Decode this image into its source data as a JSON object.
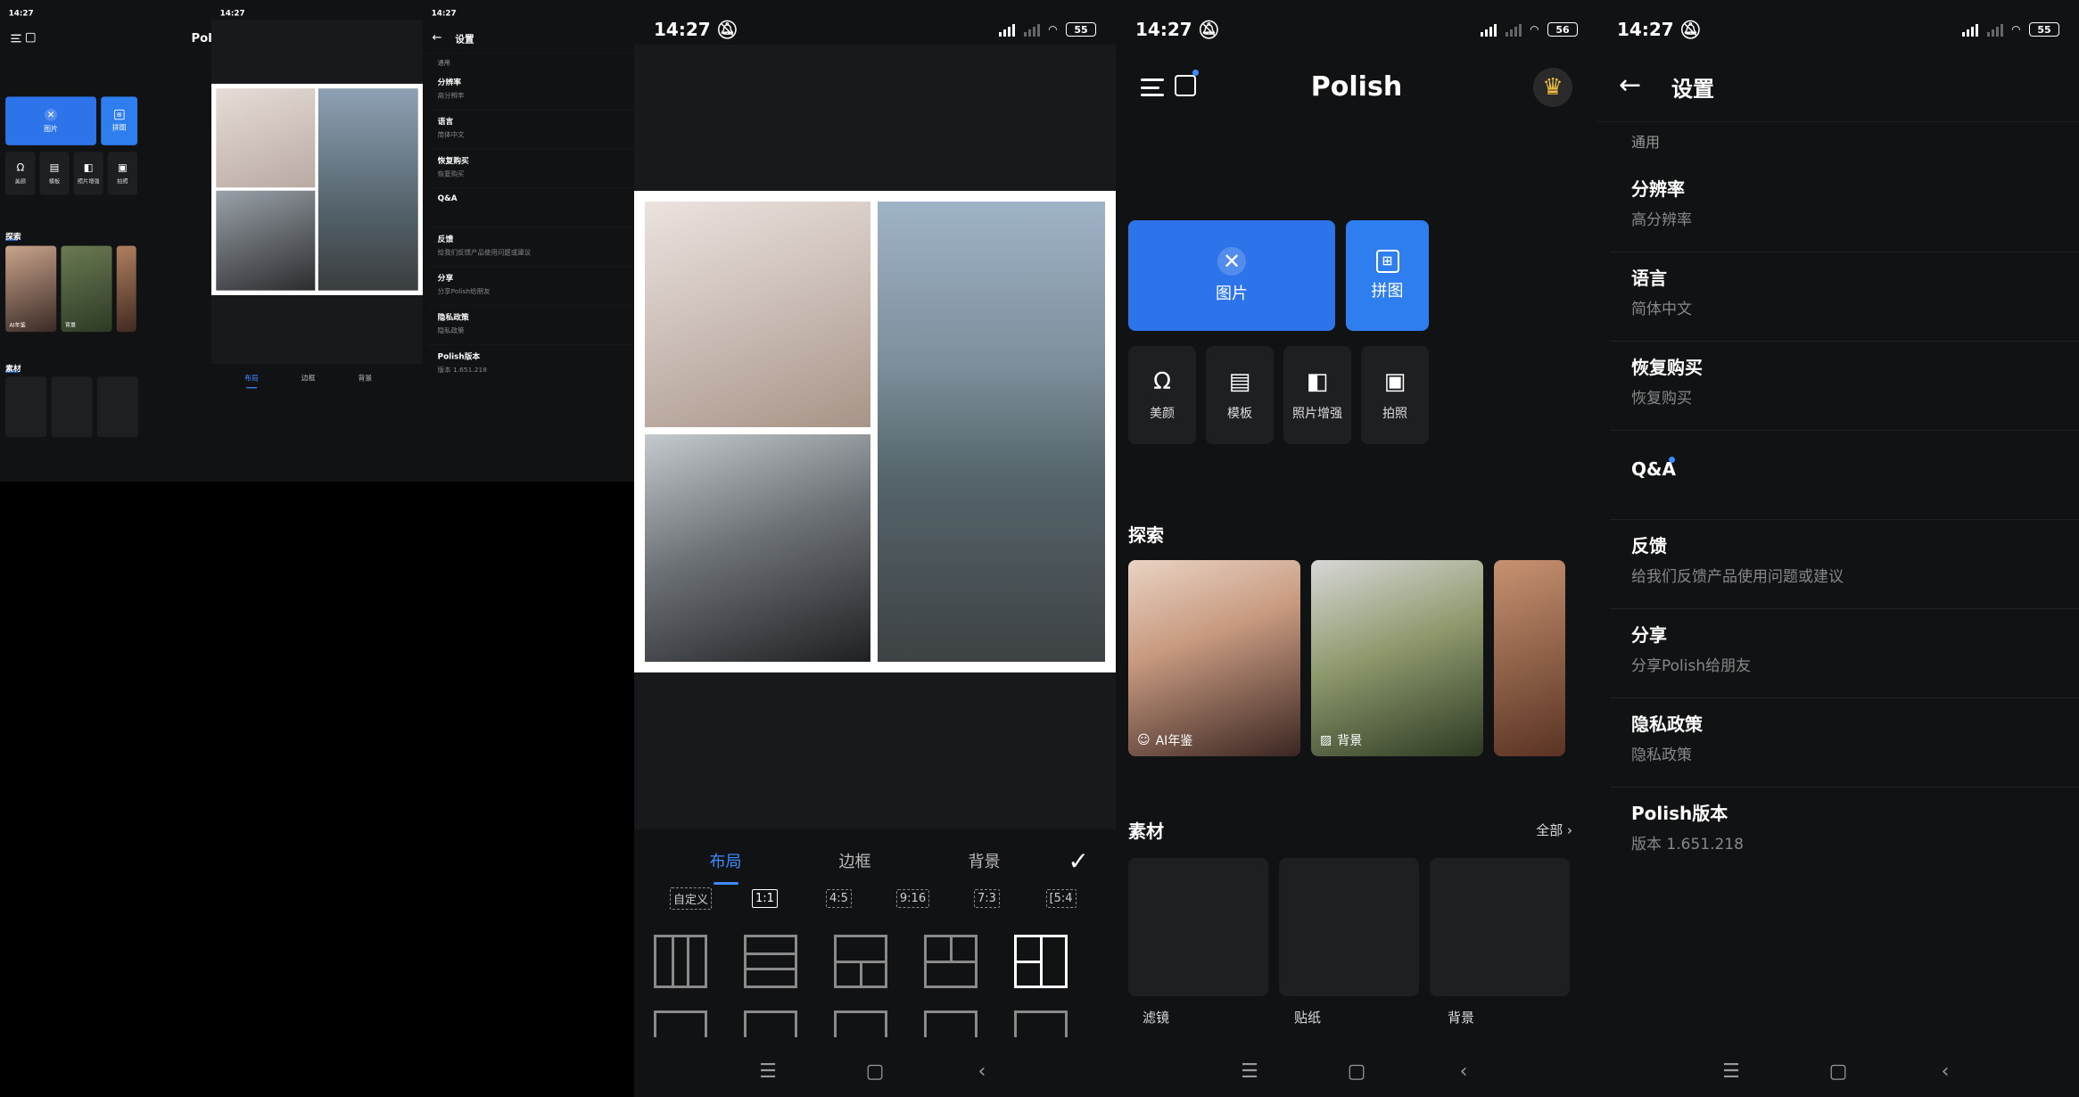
{
  "status": {
    "time": "14:27",
    "battery_collage": "55",
    "battery_home": "56",
    "battery_settings": "55"
  },
  "collage": {
    "tabs": [
      "布局",
      "边框",
      "背景"
    ],
    "ratios": [
      "自定义",
      "1:1",
      "4:5",
      "9:16",
      "7:3",
      "[5:4"
    ]
  },
  "home": {
    "logo": "Polish",
    "main_buttons": [
      "图片",
      "拼图"
    ],
    "tools": [
      "美颜",
      "模板",
      "照片增强",
      "拍照"
    ],
    "explore_title": "探索",
    "explore_cards": [
      "AI年鉴",
      "背景"
    ],
    "materials_title": "素材",
    "materials_all": "全部",
    "materials": [
      "滤镜",
      "贴纸",
      "背景"
    ]
  },
  "settings": {
    "title": "设置",
    "group": "通用",
    "items": [
      {
        "title": "分辨率",
        "sub": "高分辨率"
      },
      {
        "title": "语言",
        "sub": "简体中文"
      },
      {
        "title": "恢复购买",
        "sub": "恢复购买"
      },
      {
        "title": "Q&A",
        "sub": ""
      },
      {
        "title": "反馈",
        "sub": "给我们反馈产品使用问题或建议"
      },
      {
        "title": "分享",
        "sub": "分享Polish给朋友"
      },
      {
        "title": "隐私政策",
        "sub": "隐私政策"
      },
      {
        "title": "Polish版本",
        "sub": "版本 1.651.218"
      }
    ]
  }
}
